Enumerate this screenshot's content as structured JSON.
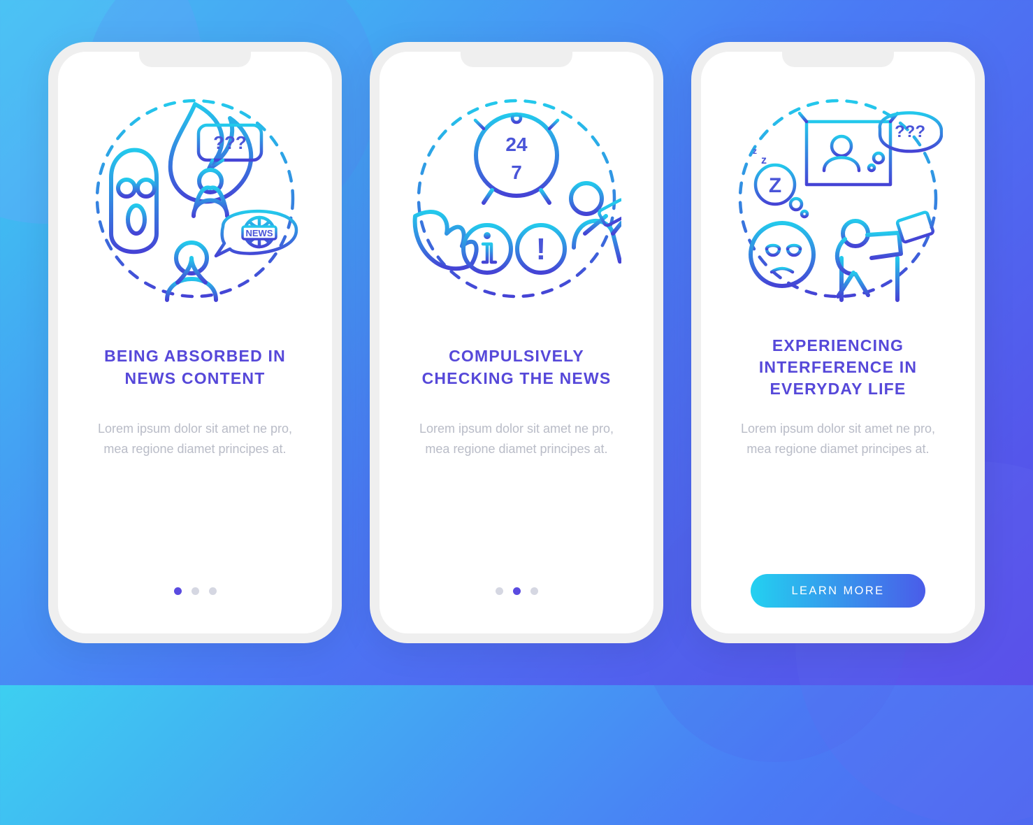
{
  "screens": [
    {
      "heading": "BEING ABSORBED IN NEWS CONTENT",
      "body": "Lorem ipsum dolor sit amet ne pro, mea regione diamet principes at.",
      "news_label": "NEWS",
      "question_marks": "???",
      "active_dot": 0
    },
    {
      "heading": "COMPULSIVELY CHECKING THE NEWS",
      "body": "Lorem ipsum dolor sit amet ne pro, mea regione diamet principes at.",
      "clock_top": "24",
      "clock_bottom": "7",
      "info_char": "i",
      "alert_char": "!",
      "active_dot": 1
    },
    {
      "heading": "EXPERIENCING INTERFERENCE IN EVERYDAY LIFE",
      "body": "Lorem ipsum dolor sit amet ne pro, mea regione diamet principes at.",
      "question_marks": "???",
      "sleep_z": "Z",
      "cta_label": "LEARN MORE"
    }
  ]
}
